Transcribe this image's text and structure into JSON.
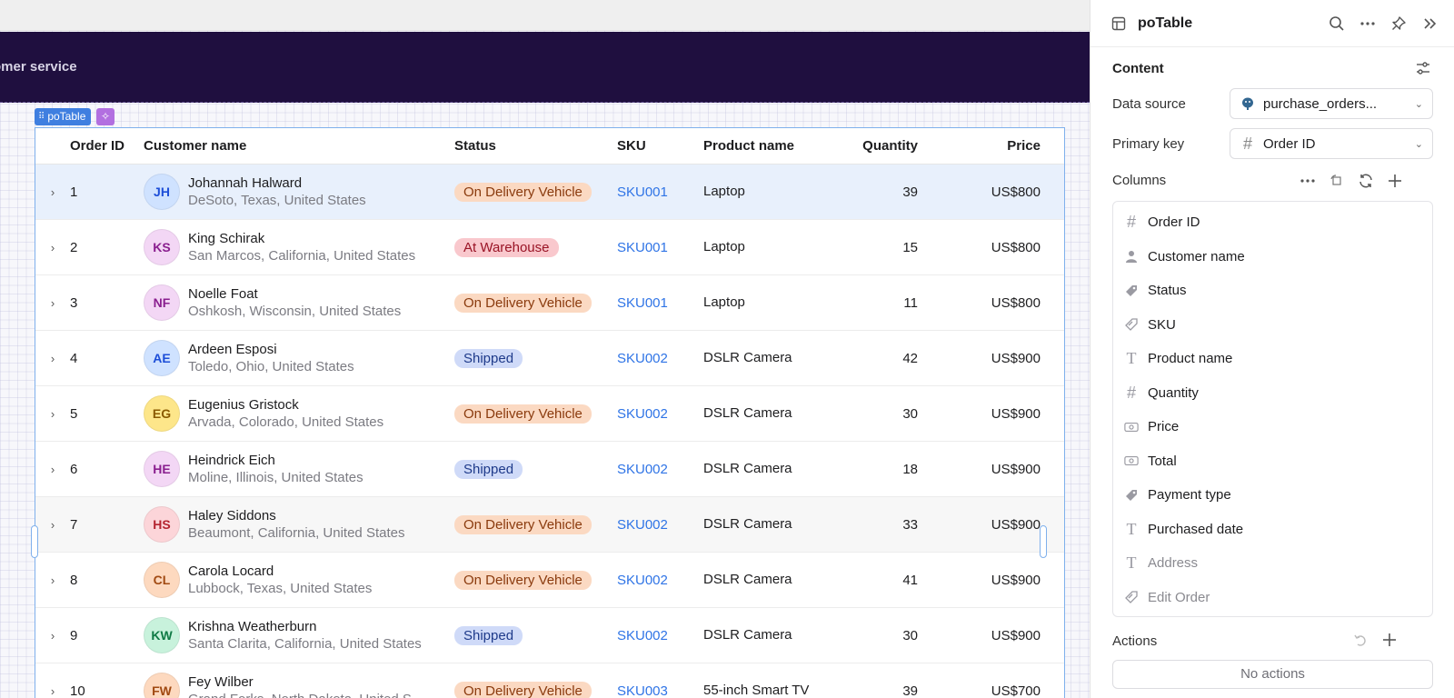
{
  "canvas": {
    "header_title": "omer service",
    "table_tag": "poTable"
  },
  "table": {
    "headers": {
      "order_id": "Order ID",
      "customer": "Customer name",
      "status": "Status",
      "sku": "SKU",
      "product": "Product name",
      "quantity": "Quantity",
      "price": "Price"
    },
    "rows": [
      {
        "id": "1",
        "initials": "JH",
        "name": "Johannah Halward",
        "location": "DeSoto, Texas, United States",
        "status": "On Delivery Vehicle",
        "status_kind": "delivery",
        "sku": "SKU001",
        "product": "Laptop",
        "quantity": "39",
        "price": "US$800",
        "avatar_bg": "#cfe2ff",
        "avatar_fg": "#1d4ed8"
      },
      {
        "id": "2",
        "initials": "KS",
        "name": "King Schirak",
        "location": "San Marcos, California, United States",
        "status": "At Warehouse",
        "status_kind": "warehouse",
        "sku": "SKU001",
        "product": "Laptop",
        "quantity": "15",
        "price": "US$800",
        "avatar_bg": "#f3d7f5",
        "avatar_fg": "#8a1f8f"
      },
      {
        "id": "3",
        "initials": "NF",
        "name": "Noelle Foat",
        "location": "Oshkosh, Wisconsin, United States",
        "status": "On Delivery Vehicle",
        "status_kind": "delivery",
        "sku": "SKU001",
        "product": "Laptop",
        "quantity": "11",
        "price": "US$800",
        "avatar_bg": "#f3d7f5",
        "avatar_fg": "#8a1f8f"
      },
      {
        "id": "4",
        "initials": "AE",
        "name": "Ardeen Esposi",
        "location": "Toledo, Ohio, United States",
        "status": "Shipped",
        "status_kind": "shipped",
        "sku": "SKU002",
        "product": "DSLR Camera",
        "quantity": "42",
        "price": "US$900",
        "avatar_bg": "#cfe2ff",
        "avatar_fg": "#1d4ed8"
      },
      {
        "id": "5",
        "initials": "EG",
        "name": "Eugenius Gristock",
        "location": "Arvada, Colorado, United States",
        "status": "On Delivery Vehicle",
        "status_kind": "delivery",
        "sku": "SKU002",
        "product": "DSLR Camera",
        "quantity": "30",
        "price": "US$900",
        "avatar_bg": "#fde68a",
        "avatar_fg": "#8a5a00"
      },
      {
        "id": "6",
        "initials": "HE",
        "name": "Heindrick Eich",
        "location": "Moline, Illinois, United States",
        "status": "Shipped",
        "status_kind": "shipped",
        "sku": "SKU002",
        "product": "DSLR Camera",
        "quantity": "18",
        "price": "US$900",
        "avatar_bg": "#f3d7f5",
        "avatar_fg": "#8a1f8f"
      },
      {
        "id": "7",
        "initials": "HS",
        "name": "Haley Siddons",
        "location": "Beaumont, California, United States",
        "status": "On Delivery Vehicle",
        "status_kind": "delivery",
        "sku": "SKU002",
        "product": "DSLR Camera",
        "quantity": "33",
        "price": "US$900",
        "avatar_bg": "#fcd5d9",
        "avatar_fg": "#b4232f"
      },
      {
        "id": "8",
        "initials": "CL",
        "name": "Carola Locard",
        "location": "Lubbock, Texas, United States",
        "status": "On Delivery Vehicle",
        "status_kind": "delivery",
        "sku": "SKU002",
        "product": "DSLR Camera",
        "quantity": "41",
        "price": "US$900",
        "avatar_bg": "#fdd9bf",
        "avatar_fg": "#a14a12"
      },
      {
        "id": "9",
        "initials": "KW",
        "name": "Krishna Weatherburn",
        "location": "Santa Clarita, California, United States",
        "status": "Shipped",
        "status_kind": "shipped",
        "sku": "SKU002",
        "product": "DSLR Camera",
        "quantity": "30",
        "price": "US$900",
        "avatar_bg": "#c8f2dc",
        "avatar_fg": "#0f7a45"
      },
      {
        "id": "10",
        "initials": "FW",
        "name": "Fey Wilber",
        "location": "Grand Forks, North Dakota, United S",
        "status": "On Delivery Vehicle",
        "status_kind": "delivery",
        "sku": "SKU003",
        "product": "55-inch Smart TV",
        "quantity": "39",
        "price": "US$700",
        "avatar_bg": "#fdd9bf",
        "avatar_fg": "#a14a12"
      }
    ]
  },
  "panel": {
    "title": "poTable",
    "content_title": "Content",
    "data_source_label": "Data source",
    "data_source_value": "purchase_orders...",
    "primary_key_label": "Primary key",
    "primary_key_value": "Order ID",
    "columns_title": "Columns",
    "columns": [
      {
        "label": "Order ID",
        "icon": "#",
        "dim": false
      },
      {
        "label": "Customer name",
        "icon": "person",
        "dim": false
      },
      {
        "label": "Status",
        "icon": "tag",
        "dim": false
      },
      {
        "label": "SKU",
        "icon": "link-tag",
        "dim": false
      },
      {
        "label": "Product name",
        "icon": "T",
        "dim": false
      },
      {
        "label": "Quantity",
        "icon": "#",
        "dim": false
      },
      {
        "label": "Price",
        "icon": "money",
        "dim": false
      },
      {
        "label": "Total",
        "icon": "money",
        "dim": false
      },
      {
        "label": "Payment type",
        "icon": "tag",
        "dim": false
      },
      {
        "label": "Purchased date",
        "icon": "T",
        "dim": false
      },
      {
        "label": "Address",
        "icon": "T",
        "dim": true
      },
      {
        "label": "Edit Order",
        "icon": "link-tag",
        "dim": true
      }
    ],
    "actions_title": "Actions",
    "no_actions": "No actions"
  }
}
